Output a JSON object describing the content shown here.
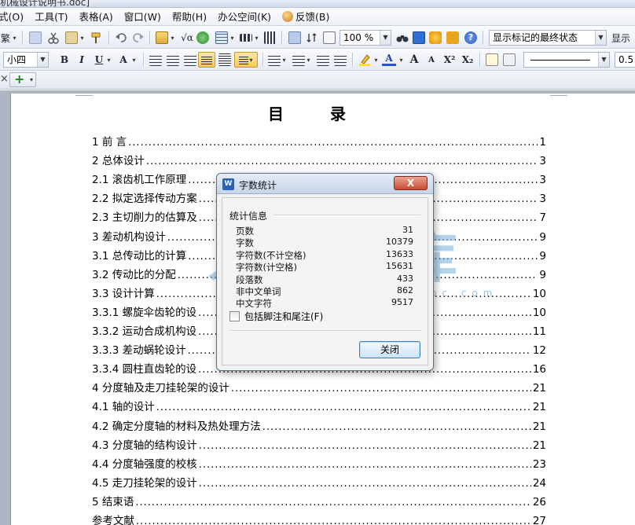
{
  "window": {
    "title": "机械设计说明书.doc]"
  },
  "menu": {
    "items": [
      "式(O)",
      "工具(T)",
      "表格(A)",
      "窗口(W)",
      "帮助(H)",
      "办公空间(K)",
      "反馈(B)"
    ]
  },
  "toolbar1": {
    "trad_chinese": "繁",
    "sqrt_symbol": "√α",
    "zoom": "100 %",
    "track_state": "显示标记的最终状态",
    "show_label": "显示"
  },
  "toolbar2": {
    "font_size": "小四",
    "bold": "B",
    "italic": "I",
    "underline": "U",
    "font_effect": "A",
    "grow_font": "A",
    "shrink_font": "A",
    "superscript": "X²",
    "subscript": "X₂",
    "line_style_value": "0.5"
  },
  "tabs": {
    "close": "×",
    "add": "+"
  },
  "document": {
    "title": "目 录",
    "toc": [
      {
        "label": "1 前  言",
        "page": "1"
      },
      {
        "label": "2 总体设计",
        "page": "3"
      },
      {
        "label": "2.1 滚齿机工作原理",
        "page": "3"
      },
      {
        "label": "2.2 拟定选择传动方案",
        "page": "3"
      },
      {
        "label": "2.3 主切削力的估算及",
        "page": "7"
      },
      {
        "label": "3  差动机构设计",
        "page": "9"
      },
      {
        "label": "3.1 总传动比的计算",
        "page": "9"
      },
      {
        "label": "3.2 传动比的分配",
        "page": "9"
      },
      {
        "label": "3.3 设计计算",
        "page": "10"
      },
      {
        "label": "3.3.1 螺旋伞齿轮的设",
        "page": "10"
      },
      {
        "label": "3.3.2 运动合成机构设",
        "page": "11"
      },
      {
        "label": "3.3.3 差动蜗轮设计",
        "page": "12"
      },
      {
        "label": "3.3.4 圆柱直齿轮的设",
        "page": "16"
      },
      {
        "label": "4  分度轴及走刀挂轮架的设计",
        "page": "21"
      },
      {
        "label": "4.1 轴的设计",
        "page": "21"
      },
      {
        "label": "4.2 确定分度轴的材料及热处理方法",
        "page": "21"
      },
      {
        "label": "4.3 分度轴的结构设计",
        "page": "21"
      },
      {
        "label": "4.4 分度轴强度的校核",
        "page": "23"
      },
      {
        "label": "4.5 走刀挂轮架的设计",
        "page": "24"
      },
      {
        "label": "5  结束语",
        "page": "26"
      },
      {
        "label": "参考文献",
        "page": "27"
      }
    ],
    "watermark": {
      "char1": "人",
      "char2": "文",
      "char3": "库",
      "url": "www.renrendoc.com"
    }
  },
  "dialog": {
    "icon": "W",
    "title": "字数统计",
    "close_label": "X",
    "group_label": "统计信息",
    "stats": [
      {
        "label": "页数",
        "value": "31"
      },
      {
        "label": "字数",
        "value": "10379"
      },
      {
        "label": "字符数(不计空格)",
        "value": "13633"
      },
      {
        "label": "字符数(计空格)",
        "value": "15631"
      },
      {
        "label": "段落数",
        "value": "433"
      },
      {
        "label": "非中文单词",
        "value": "862"
      },
      {
        "label": "中文字符",
        "value": "9517"
      }
    ],
    "include_footnotes": "包括脚注和尾注(F)",
    "ok_label": "关闭"
  }
}
